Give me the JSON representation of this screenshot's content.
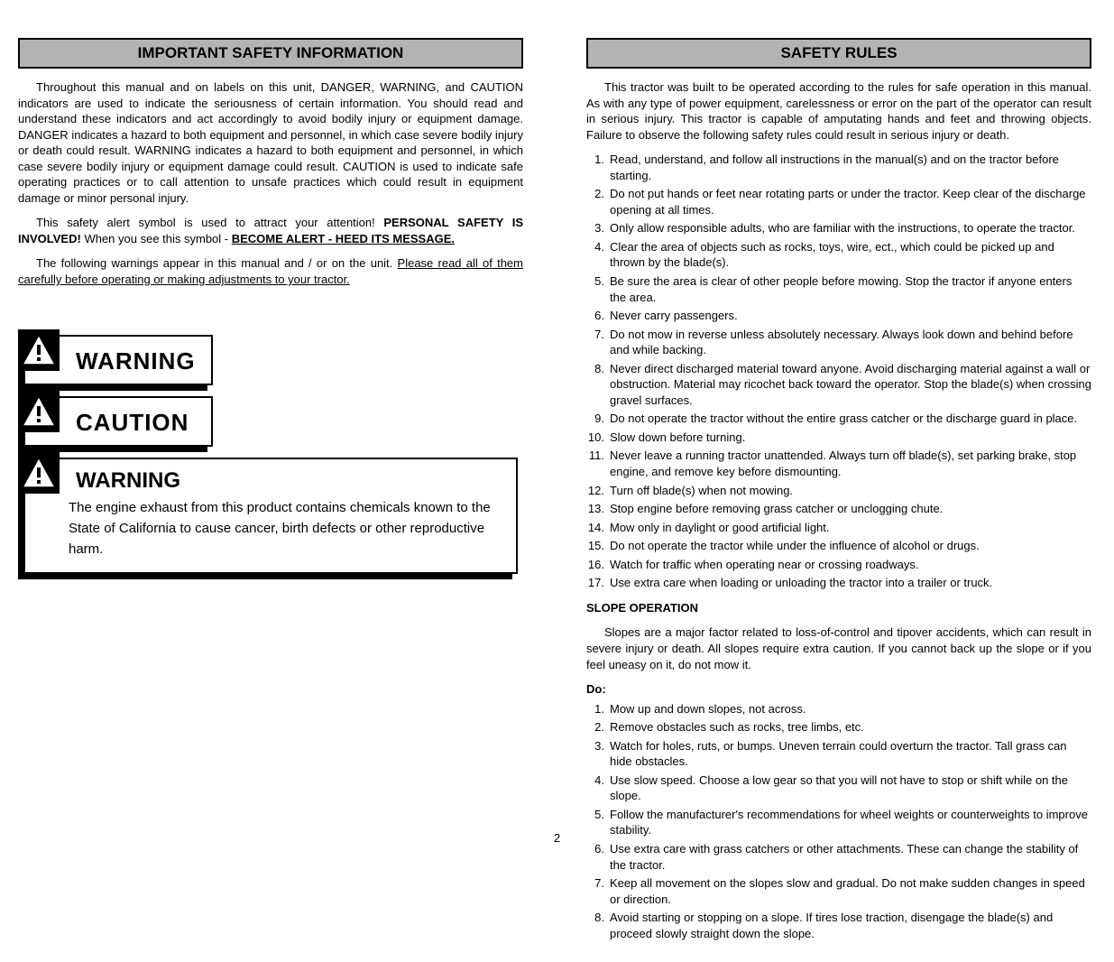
{
  "left": {
    "banner": "IMPORTANT SAFETY INFORMATION",
    "para1": "Throughout this manual and on labels on this unit, DANGER, WARNING, and CAUTION indicators are used to indicate the seriousness of certain information. You should read and understand these indicators and act accordingly to avoid bodily injury or equipment damage. DANGER indicates a hazard to both equipment and personnel, in which case severe bodily injury or death could result. WARNING indicates a hazard to both equipment and personnel, in which case severe bodily injury or equipment damage could result. CAUTION is used to indicate safe operating practices or to call attention to unsafe practices which could result in equipment damage or minor personal injury.",
    "para2_pre": "This safety alert symbol is used to attract your attention! ",
    "para2_bold": "PERSONAL SAFETY IS INVOLVED!",
    "para2_post": " When you see this symbol - ",
    "para2_under": "BECOME ALERT - HEED ITS MESSAGE.",
    "para3_part1": "The following warnings appear in this manual and / or on the unit. ",
    "para3_under": "Please read all of them carefully before operating or making adjustments to your tractor.",
    "warning_label": "WARNING",
    "caution_label": "CAUTION",
    "big_warning_label": "WARNING",
    "big_warning_text": "The engine exhaust from this product contains chemicals known to the State of California to cause cancer, birth defects or other reproductive harm."
  },
  "right": {
    "banner": "SAFETY RULES",
    "intro": "This tractor was built to be operated according to the rules for safe operation in this manual. As with any type of power equipment, carelessness or error on the part of the operator can result in serious injury. This tractor is capable of amputating hands and feet and throwing objects. Failure to observe the following safety rules could result in serious injury or death.",
    "items": [
      "Read, understand, and follow all instructions in the manual(s) and on the tractor before starting.",
      "Do not put hands or feet near rotating parts or under the tractor. Keep clear of the discharge opening at all times.",
      "Only allow responsible adults, who are familiar with the instructions, to operate the tractor.",
      "Clear the area of objects such as rocks, toys, wire, ect., which could be picked up and thrown by the blade(s).",
      "Be sure the area is clear of other people before mowing. Stop the tractor if anyone enters the area.",
      "Never carry passengers.",
      "Do not mow in reverse unless absolutely necessary. Always look down and behind before and while backing.",
      "Never direct discharged material toward anyone. Avoid discharging material against a wall or obstruction. Material may ricochet back toward the operator. Stop the blade(s) when crossing gravel surfaces.",
      "Do not operate the tractor without the entire grass catcher or the discharge guard in place.",
      "Slow down before turning.",
      "Never leave a running tractor unattended. Always turn off blade(s), set parking brake, stop engine, and remove key before dismounting.",
      "Turn off blade(s) when not mowing.",
      "Stop engine before removing grass catcher or unclogging chute.",
      "Mow only in daylight or good artificial light.",
      "Do not operate the tractor while under the influence of alcohol or drugs.",
      "Watch for traffic when operating near or crossing roadways.",
      "Use extra care when loading or unloading the tractor into a trailer or truck."
    ],
    "slope_heading": "SLOPE OPERATION",
    "slope_intro": "Slopes are a major factor related to loss-of-control and tipover accidents, which can result in severe injury or death. All slopes require extra caution. If you cannot back up the slope or if you feel uneasy on it, do not mow it.",
    "do_heading": "Do:",
    "do_items": [
      "Mow up and down slopes, not across.",
      "Remove obstacles such as rocks, tree limbs, etc.",
      "Watch for holes, ruts, or bumps. Uneven terrain could overturn the tractor. Tall grass can hide obstacles.",
      "Use slow speed. Choose a low gear so that you will not have to stop or shift while on the slope.",
      "Follow the manufacturer's recommendations for wheel weights or counterweights to improve stability.",
      "Use extra care with grass catchers or other attachments. These can change the stability of the tractor.",
      "Keep all movement on the slopes slow and gradual. Do not make sudden changes in speed or direction.",
      "Avoid starting or stopping on a slope. If tires lose traction, disengage the blade(s) and proceed slowly straight down the slope."
    ]
  },
  "page_number": "2"
}
